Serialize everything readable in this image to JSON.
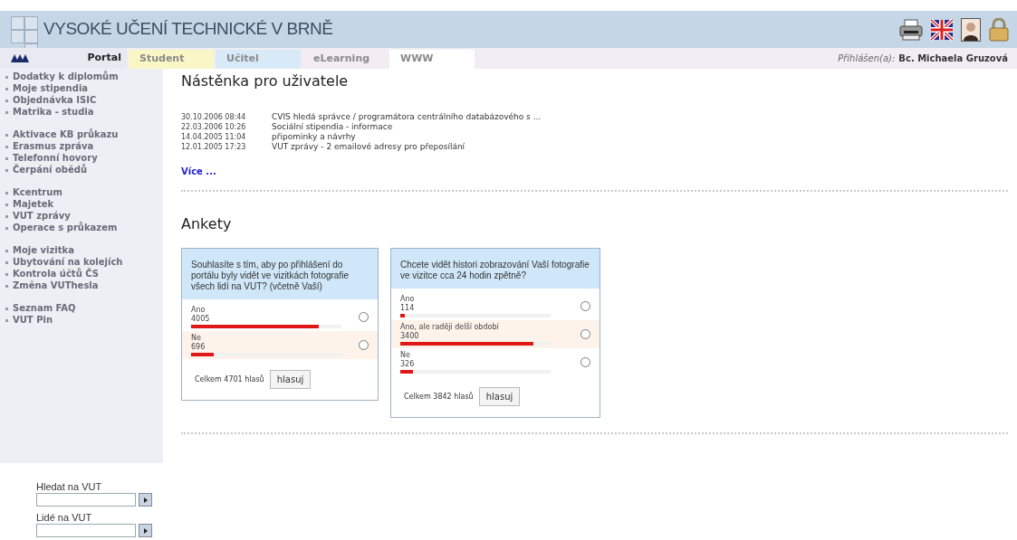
{
  "header": {
    "title": "VYSOKÉ UČENÍ TECHNICKÉ V BRNĚ"
  },
  "tabs": [
    {
      "label": "Portal",
      "selected": true,
      "color": "#e9e9f1"
    },
    {
      "label": "Student",
      "selected": false,
      "color": "#fbf6c6"
    },
    {
      "label": "Učitel",
      "selected": false,
      "color": "#d8eaf8"
    },
    {
      "label": "eLearning",
      "selected": false,
      "color": "#f3ecf1"
    },
    {
      "label": "WWW",
      "selected": false,
      "color": "#ffffff"
    }
  ],
  "login": {
    "label": "Přihlášen(a):",
    "user": "Bc. Michaela Gruzová"
  },
  "sidebar": {
    "groups": [
      {
        "items": [
          "Dodatky k diplomům",
          "Moje stipendia",
          "Objednávka ISIC",
          "Matrika - studia"
        ]
      },
      {
        "items": [
          "Aktivace KB průkazu",
          "Erasmus zpráva",
          "Telefonní hovory",
          "Čerpání obědů"
        ]
      },
      {
        "items": [
          "Kcentrum",
          "Majetek",
          "VUT zprávy",
          "Operace s průkazem"
        ]
      },
      {
        "items": [
          "Moje vizitka",
          "Ubytování na kolejích",
          "Kontrola účtů ČS",
          "Změna VUThesla"
        ]
      },
      {
        "items": [
          "Seznam FAQ",
          "VUT Pin"
        ]
      }
    ],
    "searches": [
      {
        "label": "Hledat na VUT"
      },
      {
        "label": "Lidé na VUT"
      }
    ]
  },
  "board": {
    "title": "Nástěnka pro uživatele",
    "news": [
      {
        "date": "30.10.2006 08:44",
        "text": "CVIS hledá správce / programátora centrálního databázového s ..."
      },
      {
        "date": "22.03.2006 10:26",
        "text": "Sociální stipendia - informace"
      },
      {
        "date": "14.04.2005 11:04",
        "text": "připominky a návrhy"
      },
      {
        "date": "12.01.2005 17:23",
        "text": "VUT zprávy - 2 emailové adresy pro přeposílání"
      }
    ],
    "more": "Více ..."
  },
  "polls": {
    "title": "Ankety",
    "items": [
      {
        "question": "Souhlasíte s tím, aby po přihlášení do portálu byly vidět ve vizitkách fotografie všech lidí na VUT? (včetně Vaší)",
        "options": [
          {
            "label": "Ano",
            "count": "4005",
            "level": 0.852,
            "selected": false
          },
          {
            "label": "Ne",
            "count": "696",
            "level": 0.148,
            "selected": false
          }
        ],
        "total": "Celkem 4701 hlasů",
        "button": "hlasuj"
      },
      {
        "question": "Chcete vidět histori zobrazování Vaší fotografie ve vizitce cca 24 hodin zpětně?",
        "options": [
          {
            "label": "Ano",
            "count": "114",
            "level": 0.03,
            "selected": false
          },
          {
            "label": "Ano, ale raději delší období",
            "count": "3400",
            "level": 0.885,
            "selected": false
          },
          {
            "label": "Ne",
            "count": "326",
            "level": 0.085,
            "selected": false
          }
        ],
        "total": "Celkem 3842 hlasů",
        "button": "hlasuj"
      }
    ]
  }
}
